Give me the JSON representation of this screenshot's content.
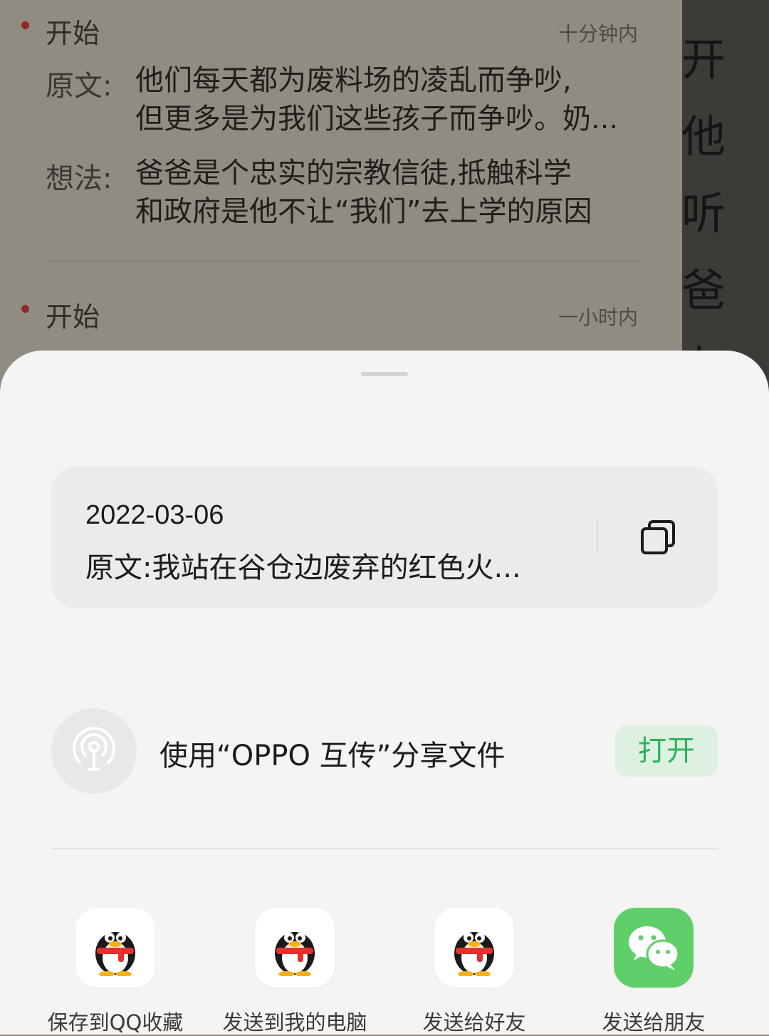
{
  "background": {
    "entries": [
      {
        "title": "开始",
        "time": "十分钟内",
        "original_label": "原文:",
        "original_lines": [
          "他们每天都为废料场的凌乱而争吵,",
          "但更多是为我们这些孩子而争吵。奶..."
        ],
        "thought_label": "想法:",
        "thought_lines": [
          "爸爸是个忠实的宗教信徒,抵触科学",
          "和政府是他不让“我们”去上学的原因"
        ]
      },
      {
        "title": "开始",
        "time": "一小时内"
      }
    ],
    "side_chars": [
      "开",
      "他",
      "听",
      "爸",
      "左"
    ]
  },
  "sheet": {
    "preview": {
      "date": "2022-03-06",
      "text": "原文:我站在谷仓边废弃的红色火..."
    },
    "oppo_share": {
      "label": "使用“OPPO 互传”分享文件",
      "button": "打开"
    },
    "apps": [
      {
        "label": "保存到QQ收藏",
        "icon": "qq-penguin-icon"
      },
      {
        "label": "发送到我的电脑",
        "icon": "qq-penguin-icon"
      },
      {
        "label": "发送给好友",
        "icon": "qq-penguin-icon"
      },
      {
        "label": "发送给朋友",
        "icon": "wechat-icon"
      }
    ]
  },
  "colors": {
    "accent_green": "#2eb35b",
    "wechat_green": "#5fcf6a",
    "bullet_red": "#8f2a22"
  }
}
